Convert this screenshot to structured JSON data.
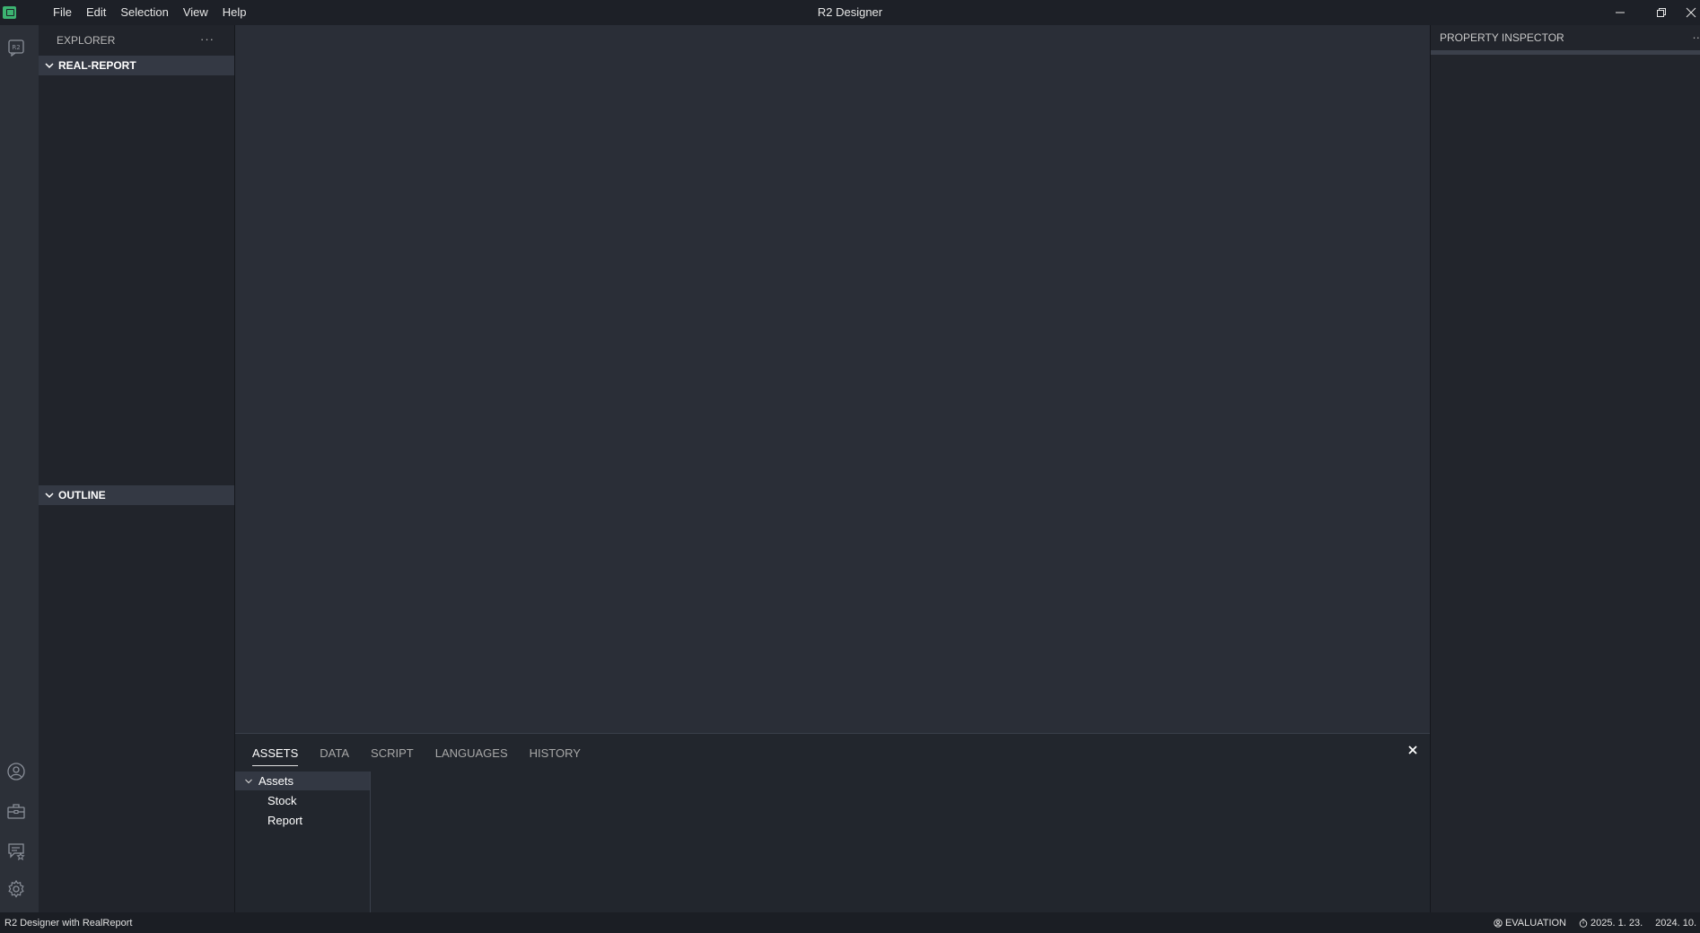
{
  "titlebar": {
    "title": "R2 Designer",
    "menu": [
      "File",
      "Edit",
      "Selection",
      "View",
      "Help"
    ]
  },
  "activitybar": {
    "icons": [
      "r2-report-icon",
      "account-icon",
      "toolbox-icon",
      "feedback-icon",
      "settings-icon"
    ]
  },
  "explorer": {
    "header": "EXPLORER",
    "more": "···",
    "sections": [
      {
        "label": "REAL-REPORT"
      },
      {
        "label": "OUTLINE"
      }
    ]
  },
  "panel": {
    "tabs": [
      "ASSETS",
      "DATA",
      "SCRIPT",
      "LANGUAGES",
      "HISTORY"
    ],
    "active_tab": "ASSETS",
    "tree": {
      "root": "Assets",
      "items": [
        "Stock",
        "Report"
      ]
    }
  },
  "inspector": {
    "header": "PROPERTY INSPECTOR",
    "more": "··"
  },
  "statusbar": {
    "left": "R2 Designer with RealReport",
    "evaluation": "EVALUATION",
    "date1": "2025. 1. 23.",
    "date2": "2024. 10."
  },
  "colors": {
    "accent": "#3cb371",
    "editor_bg": "#2a2e37",
    "section_bg": "#343944"
  }
}
